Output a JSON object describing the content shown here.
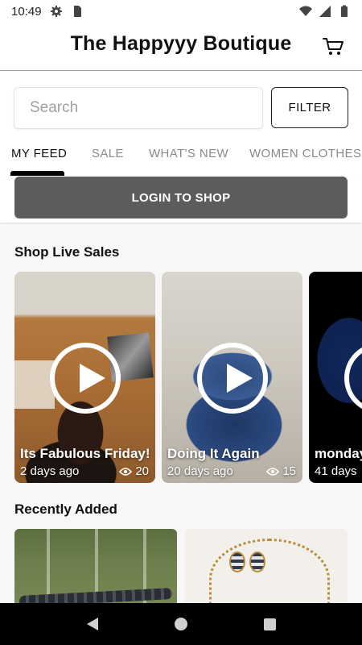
{
  "status_bar": {
    "time": "10:49",
    "icons": [
      "gear-icon",
      "sd-card-icon",
      "wifi-icon",
      "signal-icon",
      "battery-icon"
    ]
  },
  "header": {
    "title": "The Happyyy Boutique",
    "cart_icon": "cart-icon"
  },
  "search": {
    "placeholder": "Search",
    "value": "",
    "filter_label": "FILTER"
  },
  "tabs": [
    {
      "label": "MY FEED",
      "active": true
    },
    {
      "label": "SALE",
      "active": false
    },
    {
      "label": "WHAT'S NEW",
      "active": false
    },
    {
      "label": "WOMEN CLOTHES",
      "active": false
    }
  ],
  "login": {
    "label": "LOGIN TO SHOP"
  },
  "live_sales": {
    "title": "Shop Live Sales",
    "videos": [
      {
        "title": "Its Fabulous Friday!",
        "age": "2 days ago",
        "views": "20"
      },
      {
        "title": "Doing It Again",
        "age": "20 days ago",
        "views": "15"
      },
      {
        "title": "monday",
        "age": "41 days",
        "views": ""
      }
    ]
  },
  "recently_added": {
    "title": "Recently Added"
  },
  "colors": {
    "login_button": "#5c5c5c",
    "nav_bar": "#000000",
    "content_bg": "#f7f7f7"
  }
}
